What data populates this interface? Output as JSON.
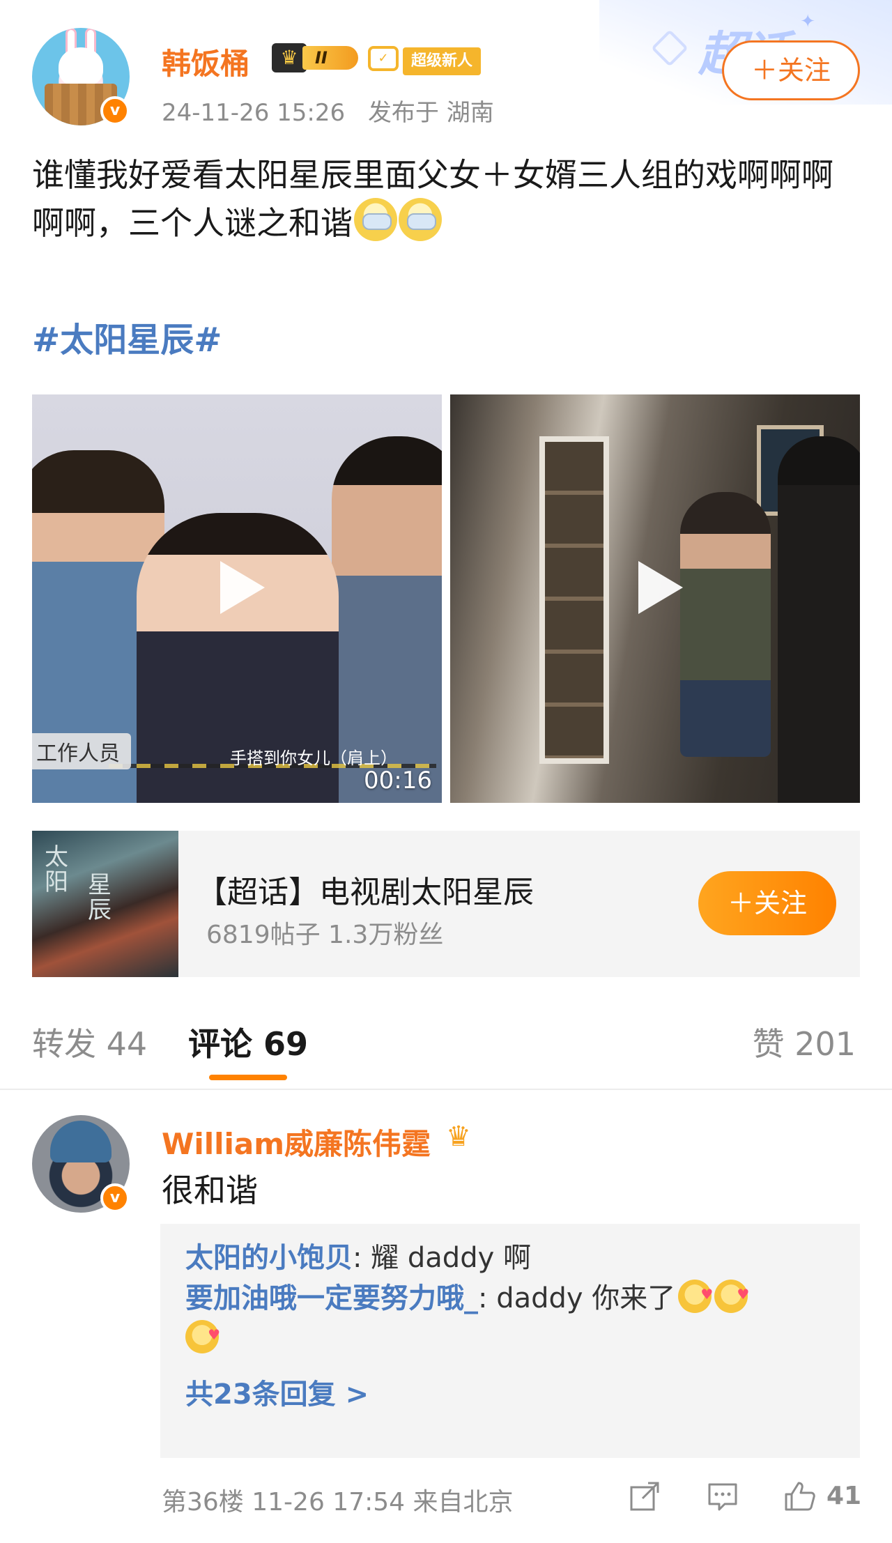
{
  "header": {
    "username": "韩饭桶",
    "level_badge": "II",
    "newbie_badge": "超级新人",
    "timestamp": "24-11-26 15:26",
    "published_from": "发布于 湖南",
    "follow_label": "＋关注",
    "deco_text": "超话"
  },
  "post": {
    "text": "谁懂我好爱看太阳星辰里面父女＋女婿三人组的戏啊啊啊啊啊，三个人谜之和谐",
    "hashtag": "#太阳星辰#"
  },
  "media": {
    "video1": {
      "staff_tag": "工作人员",
      "subtitle": "手搭到你女儿（肩上）",
      "duration": "00:16"
    }
  },
  "topic_card": {
    "title": "【超话】电视剧太阳星辰",
    "stats": "6819帖子 1.3万粉丝",
    "follow_label": "＋关注",
    "cover_title_1": "太阳",
    "cover_title_2": "星辰"
  },
  "tabs": {
    "repost": "转发 44",
    "comment": "评论 69",
    "like": "赞 201"
  },
  "comment": {
    "username": "William威廉陈伟霆",
    "text": "很和谐",
    "replies": [
      {
        "name": "太阳的小饱贝",
        "text": ": 耀 daddy 啊"
      },
      {
        "name": "要加油哦一定要努力哦_",
        "text": ": daddy 你来了"
      }
    ],
    "more_replies": "共23条回复 >",
    "meta": "第36楼  11-26 17:54  来自北京",
    "like_count": "41"
  },
  "colors": {
    "accent_orange": "#ff8200",
    "name_orange": "#f47521",
    "link_blue": "#4a7bc0",
    "muted_gray": "#8c8c8c"
  },
  "icons": [
    "verified-icon",
    "crown-icon",
    "newbie-icon",
    "play-icon",
    "share-icon",
    "comment-icon",
    "like-icon"
  ]
}
